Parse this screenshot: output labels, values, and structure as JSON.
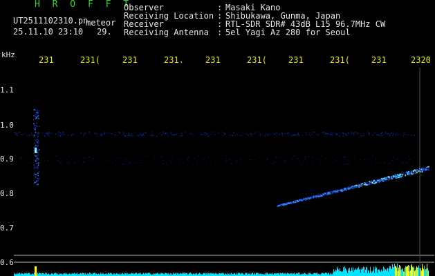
{
  "header": {
    "brand": "H R O F F T",
    "filename": "UT2511102310.pn",
    "filename_suffix": "meteor",
    "datetime": "25.11.10 23:10",
    "datetime_extra": "29.",
    "rows": [
      {
        "label": "Observer",
        "value": "Masaki Kano"
      },
      {
        "label": "Receiving Location",
        "value": "Shibukawa, Gunma, Japan"
      },
      {
        "label": "Receiver",
        "value": "RTL-SDR SDR# 43dB L15 96.7MHz CW"
      },
      {
        "label": "Receiving Antenna",
        "value": "5el Yagi Az 280 for Seoul"
      }
    ]
  },
  "axis": {
    "y_unit": "kHz",
    "x_ticks": [
      "231",
      "231(",
      "231",
      "231.",
      "231",
      "231(",
      "231",
      "231(",
      "231",
      "2320"
    ],
    "y_ticks": [
      "1.1",
      "1.0",
      "0.9",
      "0.8",
      "0.7",
      "0.6"
    ]
  },
  "colors": {
    "background": "#000000",
    "text": "#e6e6e6",
    "accent": "#e6e600",
    "brand": "#39d339",
    "signal_core": "#7ff7ff",
    "signal_mid": "#2a8cff",
    "signal_low": "#1830b0",
    "noise": "#0a1a6a",
    "spectrum": "#00e5ff",
    "spectrum_peak": "#ffff00"
  }
}
